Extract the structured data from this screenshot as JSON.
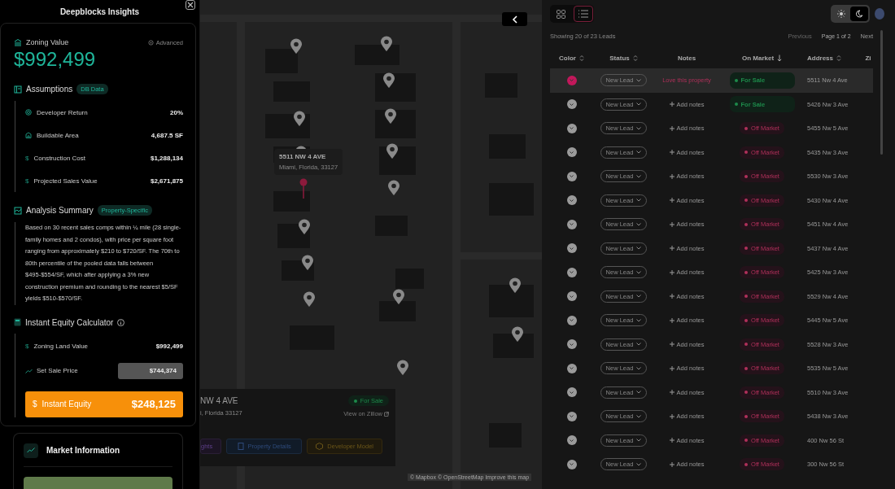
{
  "panel": {
    "title": "Deepblocks Insights",
    "zoning": {
      "label": "Zoning Value",
      "advanced": "Advanced",
      "value": "$992,499"
    },
    "assumptions": {
      "title": "Assumptions",
      "badge": "DB Data",
      "items": [
        {
          "kind": "target",
          "label": "Developer Return",
          "value": "20%"
        },
        {
          "kind": "building",
          "label": "Buildable Area",
          "value": "4,687.5 SF"
        },
        {
          "kind": "dollar",
          "symbol": "$",
          "label": "Construction Cost",
          "value": "$1,288,134"
        },
        {
          "kind": "dollar",
          "symbol": "$",
          "label": "Projected Sales Value",
          "value": "$2,671,875"
        }
      ]
    },
    "analysis": {
      "title": "Analysis Summary",
      "badge": "Property-Specific",
      "text": "Based on 30 recent sales comps within ¼ mile (28 single-family homes and 2 condos), with price per square foot ranging from approximately $210 to $720/SF. The 70th to 80th percentile of the pooled data falls between $495-$554/SF, which after applying a 3% new construction premium and rounding to the nearest $5/SF yields $510-$570/SF."
    },
    "calculator": {
      "title": "Instant Equity Calculator",
      "land_symbol": "$",
      "land_label": "Zoning Land Value",
      "land_value": "$992,499",
      "sale_label": "Set Sale Price",
      "sale_value": "$744,374",
      "equity_symbol": "$",
      "equity_label": "Instant Equity",
      "equity_value": "$248,125"
    },
    "market": {
      "title": "Market Information"
    }
  },
  "map": {
    "popup": {
      "address": "5511 NW 4 AVE",
      "city": "Miami, Florida, 33127"
    },
    "card": {
      "address": "NW 4 AVE",
      "city": "i, Florida 33127",
      "status": "For Sale",
      "zillow": "View on Zillow",
      "buttons": [
        {
          "kind": "insights",
          "label": "ghts"
        },
        {
          "kind": "details",
          "label": "Property Details"
        },
        {
          "kind": "model",
          "label": "Developer Model"
        }
      ]
    },
    "attribution": "© Mapbox © OpenStreetMap Improve this map"
  },
  "toolbar": {
    "views": [
      {
        "kind": "grid",
        "selected": false
      },
      {
        "kind": "list",
        "selected": true
      }
    ],
    "themes": [
      {
        "kind": "light",
        "selected": false
      },
      {
        "kind": "dark",
        "selected": true
      }
    ]
  },
  "leads": {
    "summary": "Showing 20 of 23 Leads",
    "previous": {
      "label": "Previous",
      "disabled": true
    },
    "page": "Page 1 of 2",
    "next": {
      "label": "Next",
      "disabled": false
    },
    "columns": [
      {
        "label": "Color",
        "kind": "sortable"
      },
      {
        "label": "Status",
        "kind": "sortable"
      },
      {
        "label": "Notes",
        "kind": "plain"
      },
      {
        "label": "On Market",
        "kind": "sorted_desc"
      },
      {
        "label": "Address",
        "kind": "sortable"
      },
      {
        "label": "Zi",
        "kind": "plain"
      }
    ],
    "rows": [
      {
        "selected": true,
        "color": "#c2185b",
        "status": "New Lead",
        "note": "Love this property",
        "market": {
          "kind": "for_sale",
          "label": "For Sale"
        },
        "address": "5511 Nw 4 Ave"
      },
      {
        "selected": false,
        "color": "#9a9a9a",
        "status": "New Lead",
        "add": "Add notes",
        "market": {
          "kind": "for_sale",
          "label": "For Sale"
        },
        "address": "5426 Nw 3 Ave"
      },
      {
        "selected": false,
        "color": "#9a9a9a",
        "status": "New Lead",
        "add": "Add notes",
        "market": {
          "kind": "off_market",
          "label": "Off Market"
        },
        "address": "5455 Nw 5 Ave"
      },
      {
        "selected": false,
        "color": "#9a9a9a",
        "status": "New Lead",
        "add": "Add notes",
        "market": {
          "kind": "off_market",
          "label": "Off Market"
        },
        "address": "5435 Nw 3 Ave"
      },
      {
        "selected": false,
        "color": "#9a9a9a",
        "status": "New Lead",
        "add": "Add notes",
        "market": {
          "kind": "off_market",
          "label": "Off Market"
        },
        "address": "5530 Nw 3 Ave"
      },
      {
        "selected": false,
        "color": "#9a9a9a",
        "status": "New Lead",
        "add": "Add notes",
        "market": {
          "kind": "off_market",
          "label": "Off Market"
        },
        "address": "5430 Nw 4 Ave"
      },
      {
        "selected": false,
        "color": "#9a9a9a",
        "status": "New Lead",
        "add": "Add notes",
        "market": {
          "kind": "off_market",
          "label": "Off Market"
        },
        "address": "5451 Nw 4 Ave"
      },
      {
        "selected": false,
        "color": "#9a9a9a",
        "status": "New Lead",
        "add": "Add notes",
        "market": {
          "kind": "off_market",
          "label": "Off Market"
        },
        "address": "5437 Nw 4 Ave"
      },
      {
        "selected": false,
        "color": "#9a9a9a",
        "status": "New Lead",
        "add": "Add notes",
        "market": {
          "kind": "off_market",
          "label": "Off Market"
        },
        "address": "5425 Nw 3 Ave"
      },
      {
        "selected": false,
        "color": "#9a9a9a",
        "status": "New Lead",
        "add": "Add notes",
        "market": {
          "kind": "off_market",
          "label": "Off Market"
        },
        "address": "5529 Nw 4 Ave"
      },
      {
        "selected": false,
        "color": "#9a9a9a",
        "status": "New Lead",
        "add": "Add notes",
        "market": {
          "kind": "off_market",
          "label": "Off Market"
        },
        "address": "5445 Nw 5 Ave"
      },
      {
        "selected": false,
        "color": "#9a9a9a",
        "status": "New Lead",
        "add": "Add notes",
        "market": {
          "kind": "off_market",
          "label": "Off Market"
        },
        "address": "5528 Nw 3 Ave"
      },
      {
        "selected": false,
        "color": "#9a9a9a",
        "status": "New Lead",
        "add": "Add notes",
        "market": {
          "kind": "off_market",
          "label": "Off Market"
        },
        "address": "5535 Nw 5 Ave"
      },
      {
        "selected": false,
        "color": "#9a9a9a",
        "status": "New Lead",
        "add": "Add notes",
        "market": {
          "kind": "off_market",
          "label": "Off Market"
        },
        "address": "5510 Nw 3 Ave"
      },
      {
        "selected": false,
        "color": "#9a9a9a",
        "status": "New Lead",
        "add": "Add notes",
        "market": {
          "kind": "off_market",
          "label": "Off Market"
        },
        "address": "5438 Nw 3 Ave"
      },
      {
        "selected": false,
        "color": "#9a9a9a",
        "status": "New Lead",
        "add": "Add notes",
        "market": {
          "kind": "off_market",
          "label": "Off Market"
        },
        "address": "400 Nw 56 St"
      },
      {
        "selected": false,
        "color": "#9a9a9a",
        "status": "New Lead",
        "add": "Add notes",
        "market": {
          "kind": "off_market",
          "label": "Off Market"
        },
        "address": "300 Nw 56 St"
      }
    ]
  }
}
